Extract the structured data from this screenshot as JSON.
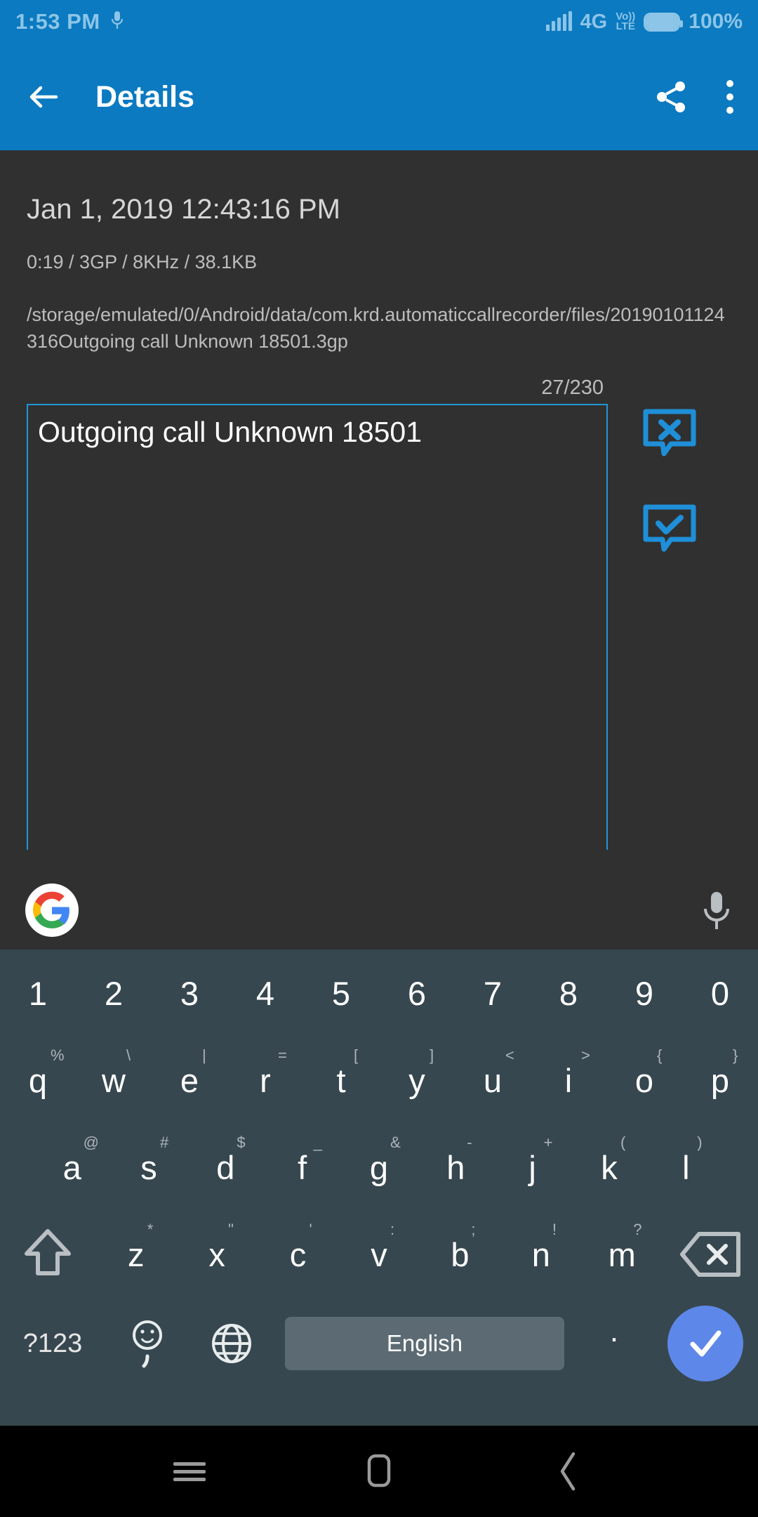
{
  "status_bar": {
    "time": "1:53 PM",
    "mic_icon": "mic-icon",
    "signal_icon": "signal-bars-icon",
    "network_type": "4G",
    "volte_top": "Vo))",
    "volte_bottom": "LTE",
    "battery_icon": "battery-full-icon",
    "battery_percent": "100%"
  },
  "app_bar": {
    "back_icon": "back-arrow-icon",
    "title": "Details",
    "share_icon": "share-icon",
    "overflow_icon": "more-vertical-icon"
  },
  "details": {
    "date": "Jan 1, 2019 12:43:16 PM",
    "meta": "0:19 / 3GP / 8KHz / 38.1KB",
    "path": "/storage/emulated/0/Android/data/com.krd.automaticcallrecorder/files/20190101124316Outgoing call Unknown 18501.3gp",
    "char_counter": "27/230",
    "note_value": "Outgoing call Unknown 18501",
    "note_placeholder": "",
    "cancel_icon": "comment-x-icon",
    "confirm_icon": "comment-check-icon",
    "accent_color": "#2196d8",
    "background_color": "#303030"
  },
  "keyboard": {
    "google_icon": "google-g-icon",
    "mic_icon": "microphone-icon",
    "numbers": [
      "1",
      "2",
      "3",
      "4",
      "5",
      "6",
      "7",
      "8",
      "9",
      "0"
    ],
    "row1": [
      {
        "key": "q",
        "sup": "%"
      },
      {
        "key": "w",
        "sup": "\\"
      },
      {
        "key": "e",
        "sup": "|"
      },
      {
        "key": "r",
        "sup": "="
      },
      {
        "key": "t",
        "sup": "["
      },
      {
        "key": "y",
        "sup": "]"
      },
      {
        "key": "u",
        "sup": "<"
      },
      {
        "key": "i",
        "sup": ">"
      },
      {
        "key": "o",
        "sup": "{"
      },
      {
        "key": "p",
        "sup": "}"
      }
    ],
    "row2": [
      {
        "key": "a",
        "sup": "@"
      },
      {
        "key": "s",
        "sup": "#"
      },
      {
        "key": "d",
        "sup": "$"
      },
      {
        "key": "f",
        "sup": "_"
      },
      {
        "key": "g",
        "sup": "&"
      },
      {
        "key": "h",
        "sup": "-"
      },
      {
        "key": "j",
        "sup": "+"
      },
      {
        "key": "k",
        "sup": "("
      },
      {
        "key": "l",
        "sup": ")"
      }
    ],
    "row3": [
      {
        "key": "z",
        "sup": "*"
      },
      {
        "key": "x",
        "sup": "\""
      },
      {
        "key": "c",
        "sup": "'"
      },
      {
        "key": "v",
        "sup": ":"
      },
      {
        "key": "b",
        "sup": ";"
      },
      {
        "key": "n",
        "sup": "!"
      },
      {
        "key": "m",
        "sup": "?"
      }
    ],
    "shift_icon": "shift-arrow-icon",
    "backspace_icon": "backspace-icon",
    "symbols_label": "?123",
    "emoji_icon": "emoji-comma-icon",
    "emoji_sub": ",",
    "globe_icon": "language-globe-icon",
    "space_label": "English",
    "period_label": ".",
    "enter_icon": "check-icon",
    "enter_color": "#5d87e8",
    "space_key_color": "#5c6b73",
    "keyboard_color": "#37474f"
  },
  "nav_bar": {
    "recents_icon": "recents-icon",
    "home_icon": "home-icon",
    "back_icon": "nav-back-icon"
  }
}
